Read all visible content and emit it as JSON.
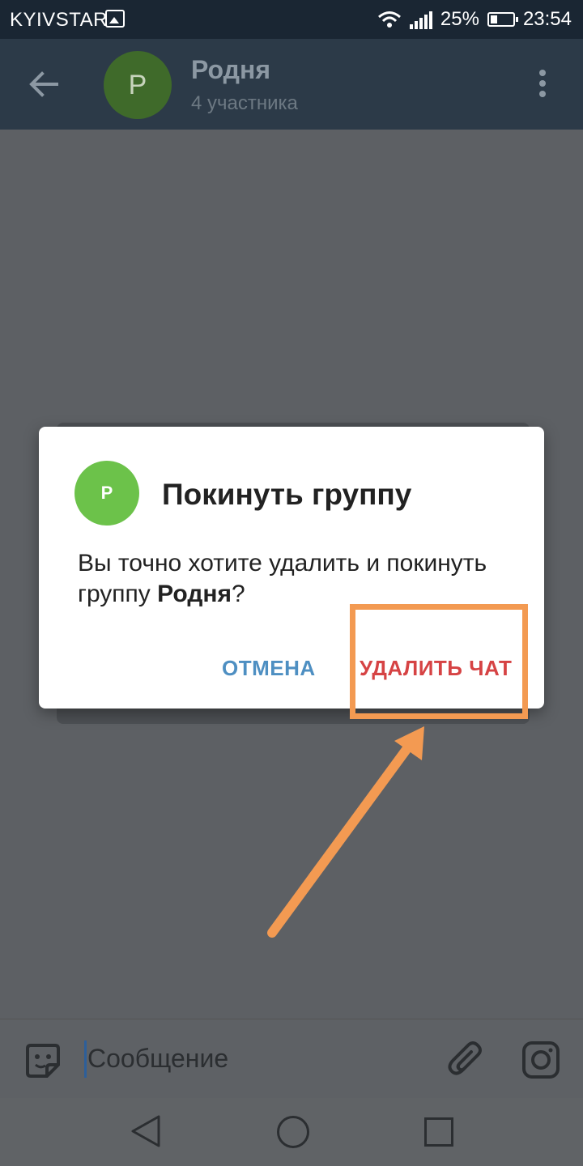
{
  "status_bar": {
    "carrier": "KYIVSTAR",
    "battery": "25%",
    "time": "23:54"
  },
  "header": {
    "avatar_letter": "Р",
    "title": "Родня",
    "subtitle": "4 участника"
  },
  "dialog": {
    "avatar_letter": "Р",
    "title": "Покинуть группу",
    "text_before": "Вы точно хотите удалить и покинуть группу ",
    "group_name": "Родня",
    "text_after": "?",
    "cancel_label": "ОТМЕНА",
    "delete_label": "УДАЛИТЬ ЧАТ"
  },
  "input": {
    "placeholder": "Сообщение"
  },
  "colors": {
    "accent_delete": "#d64344",
    "accent_cancel": "#4e8fc2",
    "annotation": "#f39a52",
    "avatar": "#6cc24a"
  }
}
